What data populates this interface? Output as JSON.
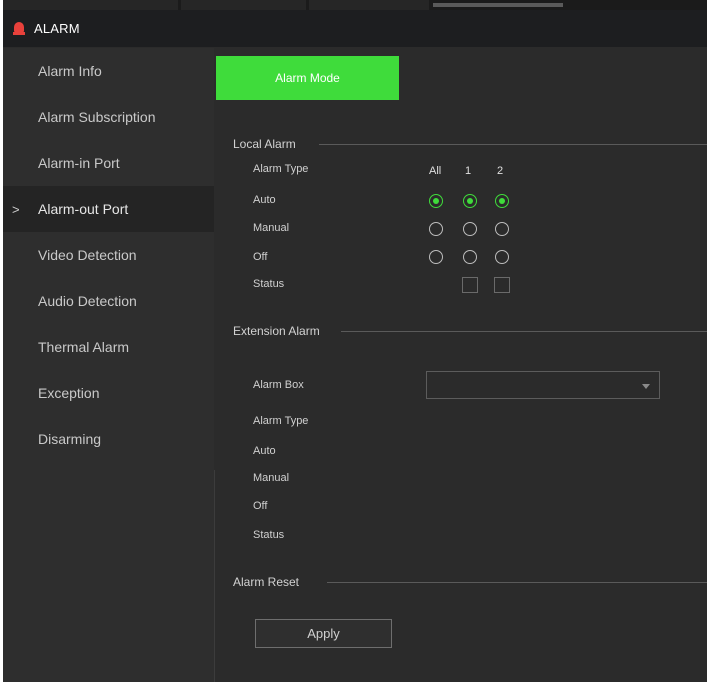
{
  "window": {
    "title": "ALARM"
  },
  "sidebar": {
    "items": [
      {
        "label": "Alarm Info"
      },
      {
        "label": "Alarm Subscription"
      },
      {
        "label": "Alarm-in Port"
      },
      {
        "label": "Alarm-out Port",
        "active": true,
        "chevron": ">"
      },
      {
        "label": "Video Detection"
      },
      {
        "label": "Audio Detection"
      },
      {
        "label": "Thermal Alarm"
      },
      {
        "label": "Exception"
      },
      {
        "label": "Disarming"
      }
    ]
  },
  "main": {
    "tab_label": "Alarm Mode",
    "local_alarm": {
      "section_title": "Local Alarm",
      "alarm_type_label": "Alarm Type",
      "columns": [
        "All",
        "1",
        "2"
      ],
      "auto_label": "Auto",
      "manual_label": "Manual",
      "off_label": "Off",
      "status_label": "Status",
      "selected_mode": "Auto"
    },
    "extension_alarm": {
      "section_title": "Extension Alarm",
      "alarm_box_label": "Alarm Box",
      "alarm_box_value": "",
      "alarm_type_label": "Alarm Type",
      "auto_label": "Auto",
      "manual_label": "Manual",
      "off_label": "Off",
      "status_label": "Status"
    },
    "alarm_reset": {
      "section_title": "Alarm Reset"
    },
    "apply_label": "Apply"
  },
  "colors": {
    "accent": "#3fdc3b",
    "alarm_icon": "#e8413b",
    "background": "#2b2b2b",
    "titlebar": "#1d1e20"
  }
}
